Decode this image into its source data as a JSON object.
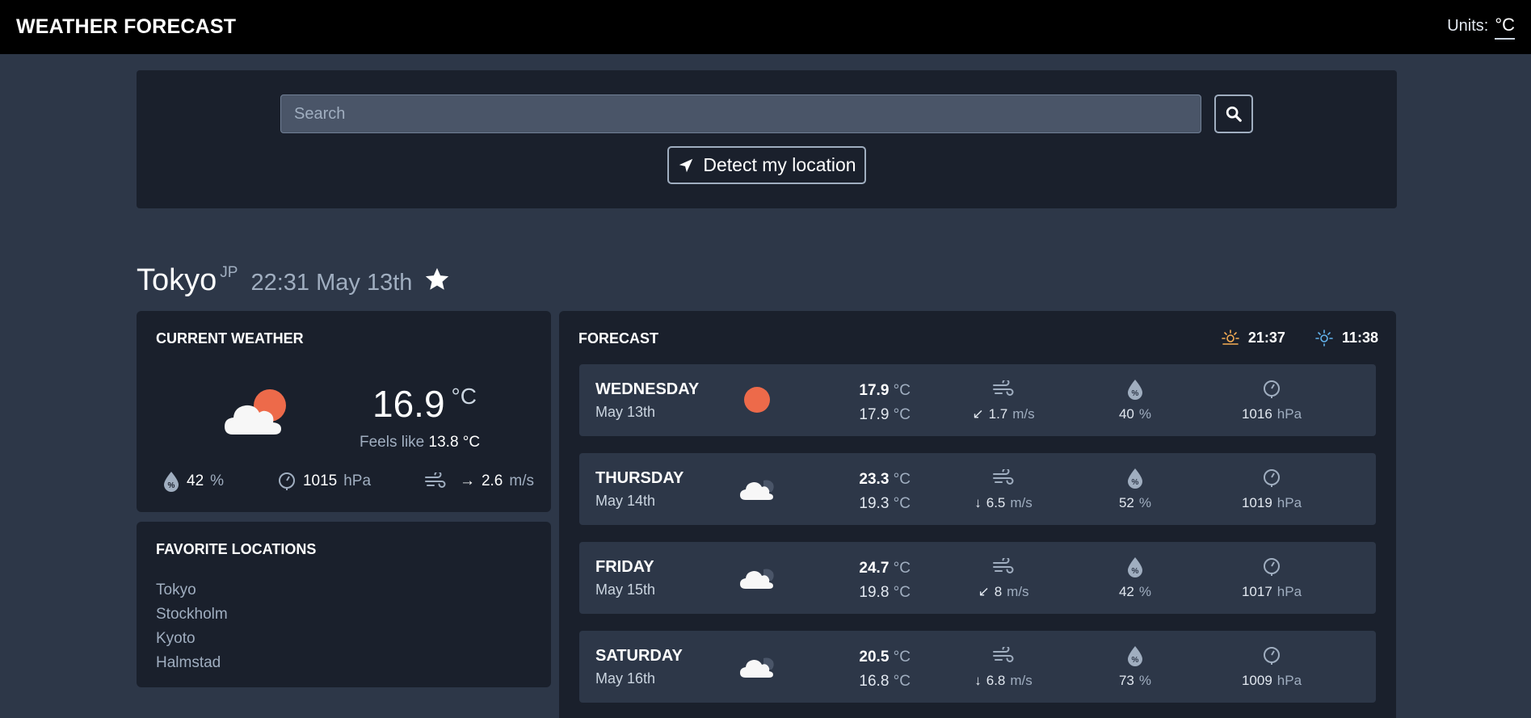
{
  "app": {
    "title": "WEATHER FORECAST",
    "units_label": "Units:",
    "units_value": "°C"
  },
  "search": {
    "placeholder": "Search",
    "detect_label": "Detect my location"
  },
  "location": {
    "city": "Tokyo",
    "country": "JP",
    "local_time": "22:31 May 13th"
  },
  "current": {
    "title": "CURRENT WEATHER",
    "icon": "partly-cloudy-icon",
    "temperature": "16.9",
    "unit": "°C",
    "feels_like_label": "Feels like",
    "feels_like": "13.8 °C",
    "humidity": "42",
    "humidity_unit": "%",
    "pressure": "1015",
    "pressure_unit": "hPa",
    "wind_arrow": "→",
    "wind": "2.6",
    "wind_unit": "m/s"
  },
  "favorites": {
    "title": "FAVORITE LOCATIONS",
    "items": [
      "Tokyo",
      "Stockholm",
      "Kyoto",
      "Halmstad"
    ]
  },
  "forecast": {
    "title": "FORECAST",
    "sunrise": "21:37",
    "sunset": "11:38",
    "unit": "°C",
    "wind_unit": "m/s",
    "humidity_unit": "%",
    "pressure_unit": "hPa",
    "days": [
      {
        "name": "WEDNESDAY",
        "date": "May 13th",
        "icon": "sun-icon",
        "max": "17.9",
        "min": "17.9",
        "wind_arrow": "↙",
        "wind": "1.7",
        "humidity": "40",
        "pressure": "1016"
      },
      {
        "name": "THURSDAY",
        "date": "May 14th",
        "icon": "cloud-icon",
        "max": "23.3",
        "min": "19.3",
        "wind_arrow": "↓",
        "wind": "6.5",
        "humidity": "52",
        "pressure": "1019"
      },
      {
        "name": "FRIDAY",
        "date": "May 15th",
        "icon": "cloud-icon",
        "max": "24.7",
        "min": "19.8",
        "wind_arrow": "↙",
        "wind": "8",
        "humidity": "42",
        "pressure": "1017"
      },
      {
        "name": "SATURDAY",
        "date": "May 16th",
        "icon": "cloud-icon",
        "max": "20.5",
        "min": "16.8",
        "wind_arrow": "↓",
        "wind": "6.8",
        "humidity": "73",
        "pressure": "1009"
      }
    ]
  },
  "colors": {
    "background": "#2d3748",
    "panel": "#1a202c",
    "topbar": "#000000",
    "sun": "#ed6a4a",
    "sunrise": "#f6ad55",
    "sunset": "#63b3ed"
  }
}
